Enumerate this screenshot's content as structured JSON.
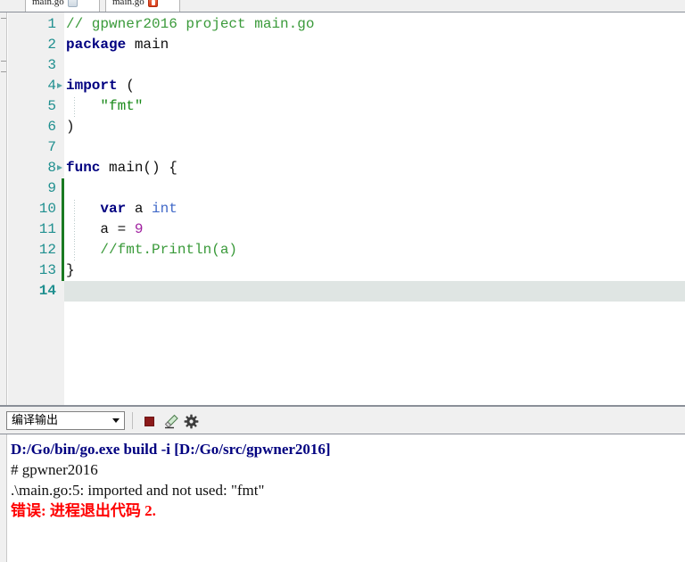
{
  "window": {
    "title": "Go IDE editor with compile output"
  },
  "tabs": [
    {
      "label": "main.go",
      "badge": "window-restore-icon",
      "active": false
    },
    {
      "label": "main.go",
      "badge": "error-icon",
      "active": true
    }
  ],
  "editor": {
    "language": "go",
    "active_line": 14,
    "lines": [
      {
        "number": "1",
        "fold": false,
        "changed": false,
        "indent_guide": false,
        "tokens": [
          {
            "t": "// gpwner2016 project main.go",
            "c": "cmt"
          }
        ]
      },
      {
        "number": "2",
        "fold": false,
        "changed": false,
        "indent_guide": false,
        "tokens": [
          {
            "t": "package",
            "c": "kw"
          },
          {
            "t": " main",
            "c": "pln"
          }
        ]
      },
      {
        "number": "3",
        "fold": false,
        "changed": false,
        "indent_guide": false,
        "tokens": []
      },
      {
        "number": "4",
        "fold": true,
        "changed": false,
        "indent_guide": false,
        "tokens": [
          {
            "t": "import",
            "c": "kw"
          },
          {
            "t": " (",
            "c": "pln"
          }
        ]
      },
      {
        "number": "5",
        "fold": false,
        "changed": false,
        "indent_guide": true,
        "tokens": [
          {
            "t": "    ",
            "c": "pln"
          },
          {
            "t": "\"fmt\"",
            "c": "str"
          }
        ]
      },
      {
        "number": "6",
        "fold": false,
        "changed": false,
        "indent_guide": false,
        "tokens": [
          {
            "t": ")",
            "c": "pln"
          }
        ]
      },
      {
        "number": "7",
        "fold": false,
        "changed": false,
        "indent_guide": false,
        "tokens": []
      },
      {
        "number": "8",
        "fold": true,
        "changed": false,
        "indent_guide": false,
        "tokens": [
          {
            "t": "func",
            "c": "kw"
          },
          {
            "t": " main() {",
            "c": "pln"
          }
        ]
      },
      {
        "number": "9",
        "fold": false,
        "changed": true,
        "indent_guide": false,
        "tokens": []
      },
      {
        "number": "10",
        "fold": false,
        "changed": true,
        "indent_guide": true,
        "tokens": [
          {
            "t": "    ",
            "c": "pln"
          },
          {
            "t": "var",
            "c": "kw"
          },
          {
            "t": " a ",
            "c": "pln"
          },
          {
            "t": "int",
            "c": "typ"
          }
        ]
      },
      {
        "number": "11",
        "fold": false,
        "changed": true,
        "indent_guide": true,
        "tokens": [
          {
            "t": "    a = ",
            "c": "pln"
          },
          {
            "t": "9",
            "c": "num"
          }
        ]
      },
      {
        "number": "12",
        "fold": false,
        "changed": true,
        "indent_guide": true,
        "tokens": [
          {
            "t": "    ",
            "c": "pln"
          },
          {
            "t": "//fmt.Println(a)",
            "c": "cmt"
          }
        ]
      },
      {
        "number": "13",
        "fold": false,
        "changed": true,
        "indent_guide": false,
        "tokens": [
          {
            "t": "}",
            "c": "pln"
          }
        ]
      },
      {
        "number": "14",
        "fold": false,
        "changed": false,
        "indent_guide": false,
        "tokens": []
      }
    ]
  },
  "output_toolbar": {
    "selected": "编译输出",
    "options": [
      "编译输出"
    ],
    "stop_button": "stop-icon",
    "clear_button": "eraser-icon",
    "settings_button": "gear-icon"
  },
  "output": {
    "lines": [
      {
        "text": "D:/Go/bin/go.exe build -i [D:/Go/src/gpwner2016]",
        "style": "cmd"
      },
      {
        "text": "# gpwner2016",
        "style": "plain"
      },
      {
        "text": ".\\main.go:5: imported and not used: \"fmt\"",
        "style": "plain"
      },
      {
        "text": "错误: 进程退出代码 2.",
        "style": "err"
      }
    ]
  },
  "colors": {
    "keyword": "#000080",
    "type": "#4169c8",
    "number": "#a020a0",
    "string": "#1a8a1a",
    "comment": "#3a9a3a",
    "line_number": "#1f8f8f",
    "active_line_bg": "#dfe5e3",
    "change_bar": "#1a7a22",
    "error_text": "#ff0000",
    "panel_bg": "#f0f0f0"
  }
}
